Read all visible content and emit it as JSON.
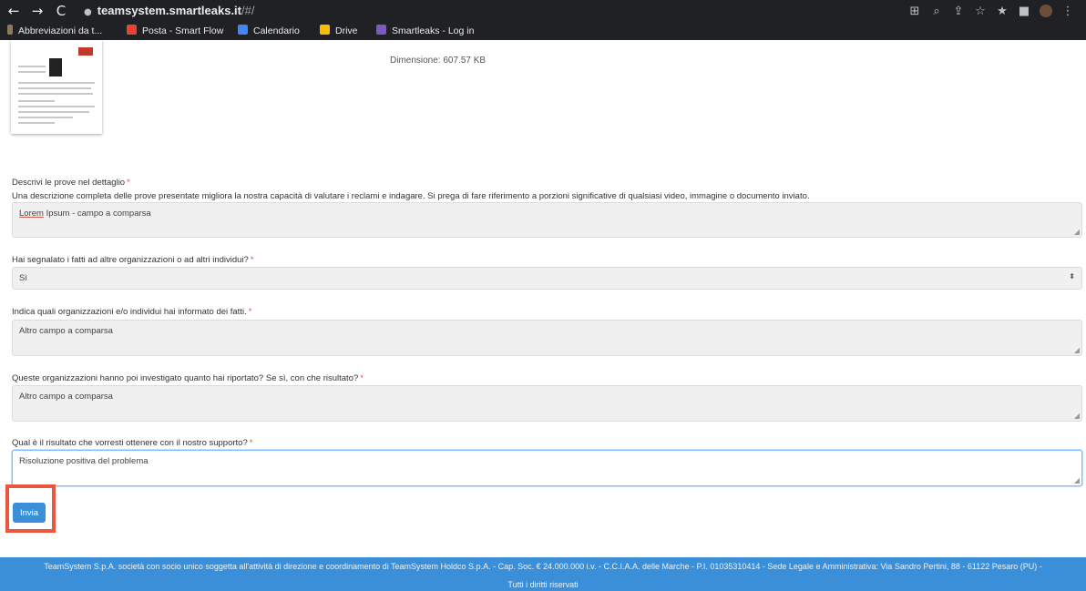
{
  "browser": {
    "url_host": "teamsystem.smartleaks.it",
    "url_path": "/#/",
    "bookmarks": [
      {
        "label": "Abbreviazioni da t...",
        "icon": "leaf-icon",
        "color": "#8d7a5c"
      },
      {
        "label": "Posta - Smart Flow",
        "icon": "gmail-icon",
        "color": "#ea4335"
      },
      {
        "label": "Calendario",
        "icon": "calendar-icon",
        "color": "#4285f4"
      },
      {
        "label": "Drive",
        "icon": "drive-icon",
        "color": "#fbbc04"
      },
      {
        "label": "Smartleaks - Log in",
        "icon": "smartleaks-icon",
        "color": "#7e57c2"
      }
    ]
  },
  "attachment": {
    "dimension_text": "Dimensione: 607.57 KB"
  },
  "form": {
    "details": {
      "label": "Descrivi le prove nel dettaglio",
      "help": "Una descrizione completa delle prove presentate migliora la nostra capacità di valutare i reclami e indagare. Si prega di fare riferimento a porzioni significative di qualsiasi video, immagine o documento inviato.",
      "value_word1": "Lorem",
      "value_rest": " Ipsum - campo a comparsa"
    },
    "reported": {
      "label": "Hai segnalato i fatti ad altre organizzazioni o ad altri individui?",
      "value": "Sì"
    },
    "which_orgs": {
      "label": "Indica quali organizzazioni e/o individui hai informato dei fatti.",
      "value": "Altro campo a comparsa"
    },
    "investigated": {
      "label": "Queste organizzazioni hanno poi investigato quanto hai riportato? Se sì, con che risultato?",
      "value": "Altro campo a comparsa"
    },
    "desired_result": {
      "label": "Qual è il risultato che vorresti ottenere con il nostro supporto?",
      "value": "Risoluzione positiva del problema"
    },
    "required_mark": "*",
    "submit_label": "Invia"
  },
  "footer": {
    "line1": "TeamSystem S.p.A. società con socio unico soggetta all'attività di direzione e coordinamento di TeamSystem Holdco S.p.A. - Cap. Soc. € 24.000.000 i.v. - C.C.I.A.A. delle Marche - P.I. 01035310414 - Sede Legale e Amministrativa: Via Sandro Pertini, 88 - 61122 Pesaro (PU) -",
    "line2": "Tutti i diritti riservati"
  },
  "colors": {
    "accent": "#3b8fd9",
    "required": "#d9534f",
    "highlight": "#e8573e"
  }
}
